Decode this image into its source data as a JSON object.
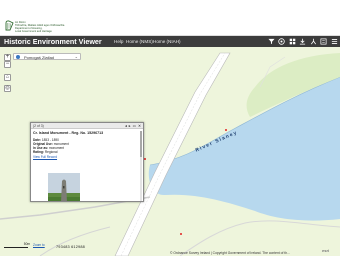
{
  "banner": {
    "dept_lines": [
      "An Roinn",
      "Tithíochta, Rialtais Áitiúil agus Oidhreachta",
      "Department of Housing,",
      "Local Government and Heritage"
    ]
  },
  "app": {
    "title": "Historic Environment Viewer",
    "nav": [
      "Help",
      "Home (NMS)",
      "Home (NIAH)"
    ],
    "tools": [
      "filter-icon",
      "basemap-icon",
      "layers-icon",
      "download-icon",
      "measure-icon",
      "print-icon",
      "menu-icon"
    ]
  },
  "map": {
    "layer_select": "Pomogaš Zlatlad",
    "zoom_in": "+",
    "zoom_out": "−",
    "home": "⌂",
    "locate": "◎",
    "river_label": "River Slaney",
    "scale_label": "50m",
    "coords": "793483 612988",
    "attribution": "© Ordnance Survey Ireland | Copyright Government of Ireland. The content of th...",
    "esri": "esri"
  },
  "popup": {
    "pager": "(2 of 3)",
    "title": "Cr. Island Monument - Reg. No. 15296713",
    "fields": [
      {
        "label": "Date:",
        "value": "1853 - 1890"
      },
      {
        "label": "Original Use:",
        "value": "monument"
      },
      {
        "label": "In Use as:",
        "value": "monument"
      },
      {
        "label": "Rating:",
        "value": "Regional"
      }
    ],
    "more": "View Full Record",
    "zoom": "Zoom to"
  }
}
